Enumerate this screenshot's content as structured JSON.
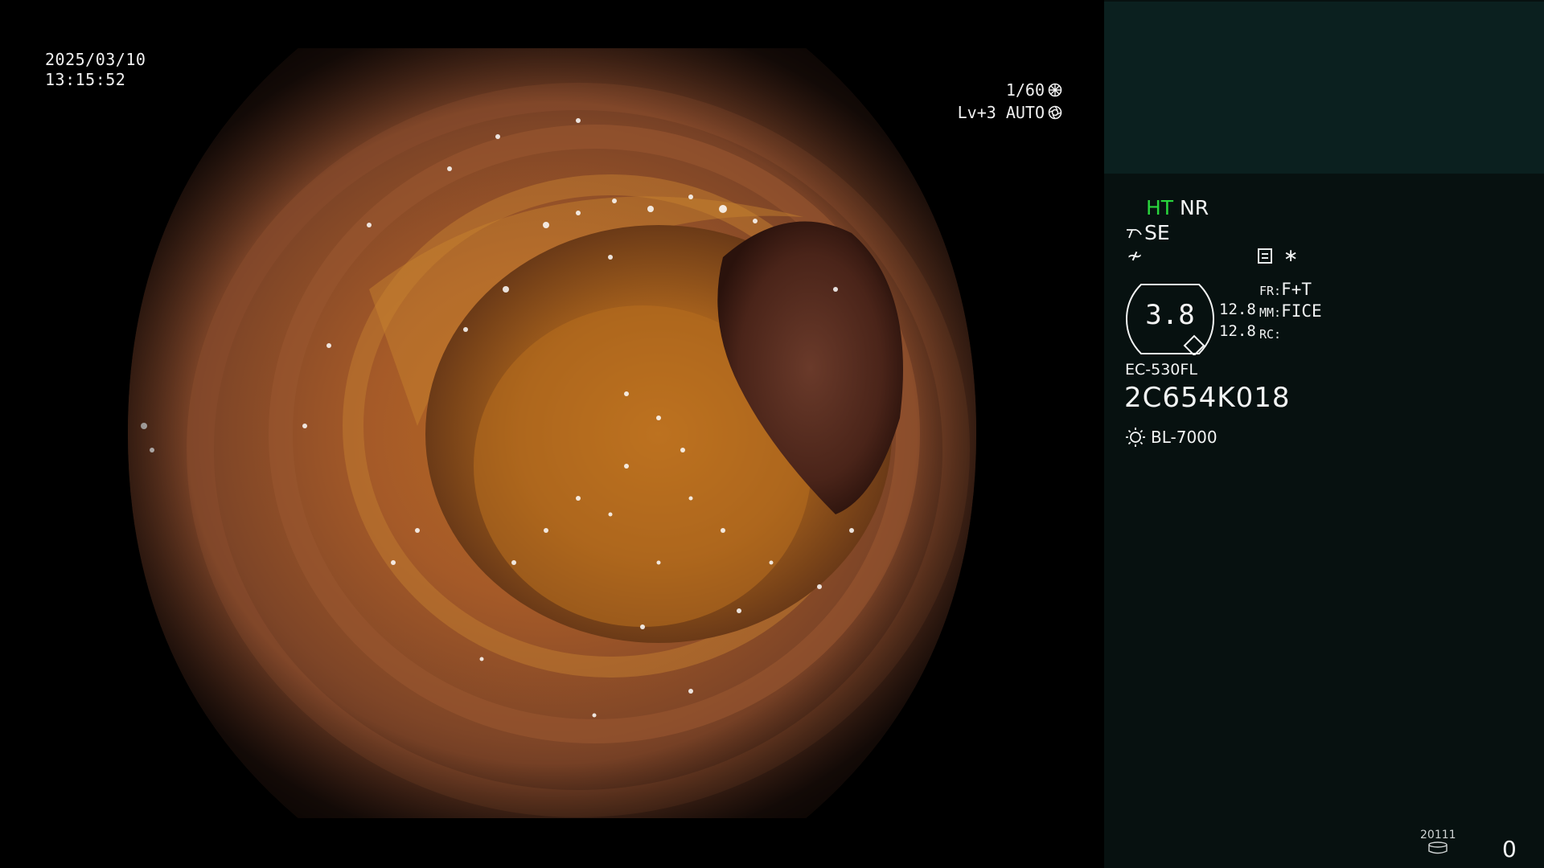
{
  "video": {
    "date": "2025/03/10",
    "time": "13:15:52",
    "shutter": "1/60",
    "level_auto": "Lv+3 AUTO",
    "shutter_icon": "shutter-wheel-icon",
    "auto_icon": "iris-icon"
  },
  "panel": {
    "ht_label": "HT",
    "nr_label": "NR",
    "se_label": "SE",
    "se_icon": "structure-enhance-icon",
    "f_symbol": "≁",
    "record_icon": "document-icon",
    "star_symbol": "∗",
    "magnification": "3.8",
    "magnif_sub_1": "12.8",
    "magnif_sub_2": "12.8",
    "fr_key": "FR:",
    "fr_value": "F+T",
    "mm_key": "MM:",
    "mm_value": "FICE",
    "rc_key": "RC:",
    "rc_value": "",
    "scope_model": "EC-530FL",
    "scope_serial": "2C654K018",
    "light_icon": "light-source-icon",
    "light_source": "BL-7000",
    "storage_count": "20111",
    "storage_icon": "storage-disk-icon",
    "counter": "0"
  },
  "colors": {
    "ht_green": "#29d63d",
    "panel_bg": "#071110",
    "panel_top_bg": "#0b201f"
  }
}
